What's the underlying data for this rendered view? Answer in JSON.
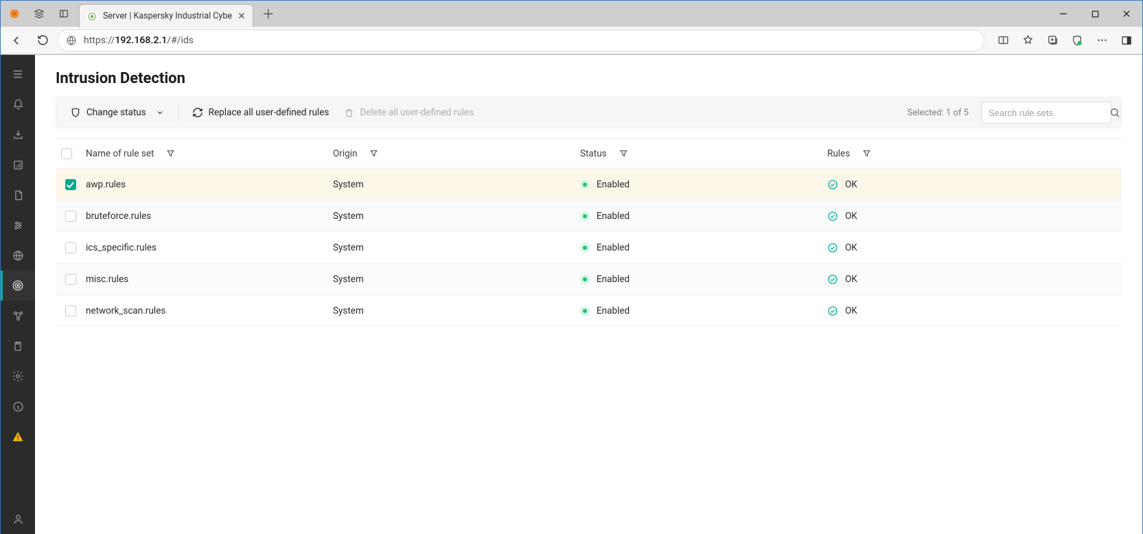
{
  "browser": {
    "tab_title": "Server | Kaspersky Industrial Cybe",
    "url_prefix": "https://",
    "url_host": "192.168.2.1",
    "url_path": "/#/ids"
  },
  "page": {
    "title": "Intrusion Detection"
  },
  "actions": {
    "change_status": "Change status",
    "replace_rules": "Replace all user-defined rules",
    "delete_rules": "Delete all user-defined rules",
    "selected_text": "Selected: 1 of 5",
    "search_placeholder": "Search rule sets"
  },
  "table": {
    "headers": {
      "name": "Name of rule set",
      "origin": "Origin",
      "status": "Status",
      "rules": "Rules"
    },
    "rows": [
      {
        "name": "awp.rules",
        "origin": "System",
        "status": "Enabled",
        "rules": "OK",
        "checked": true
      },
      {
        "name": "bruteforce.rules",
        "origin": "System",
        "status": "Enabled",
        "rules": "OK",
        "checked": false
      },
      {
        "name": "ics_specific.rules",
        "origin": "System",
        "status": "Enabled",
        "rules": "OK",
        "checked": false
      },
      {
        "name": "misc.rules",
        "origin": "System",
        "status": "Enabled",
        "rules": "OK",
        "checked": false
      },
      {
        "name": "network_scan.rules",
        "origin": "System",
        "status": "Enabled",
        "rules": "OK",
        "checked": false
      }
    ]
  }
}
